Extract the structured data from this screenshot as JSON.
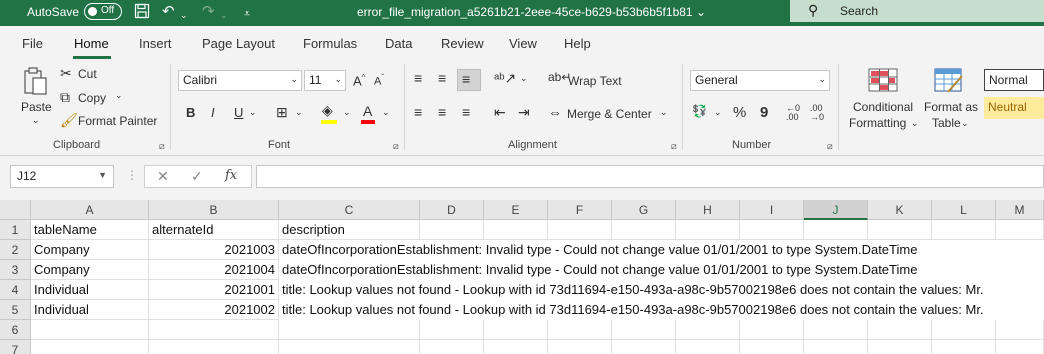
{
  "titlebar": {
    "autosave_label": "AutoSave",
    "autosave_state": "Off",
    "filename": "error_file_migration_a5261b21-2eee-45ce-b629-b53b6b5f1b81",
    "filename_chevron": "⌄",
    "search_label": "Search"
  },
  "menu": {
    "items": [
      "File",
      "Home",
      "Insert",
      "Page Layout",
      "Formulas",
      "Data",
      "Review",
      "View",
      "Help"
    ]
  },
  "ribbon": {
    "clipboard": {
      "paste": "Paste",
      "cut": "Cut",
      "copy": "Copy",
      "format_painter": "Format Painter",
      "group_label": "Clipboard"
    },
    "font": {
      "font_name": "Calibri",
      "font_size": "11",
      "bold": "B",
      "italic": "I",
      "underline": "U",
      "group_label": "Font"
    },
    "alignment": {
      "wrap_text": "Wrap Text",
      "merge_center": "Merge & Center",
      "group_label": "Alignment"
    },
    "number": {
      "format": "General",
      "percent": "%",
      "comma": "9",
      "group_label": "Number"
    },
    "styles": {
      "conditional_line1": "Conditional",
      "conditional_line2": "Formatting",
      "format_table_line1": "Format as",
      "format_table_line2": "Table",
      "normal": "Normal",
      "neutral": "Neutral"
    }
  },
  "formula_bar": {
    "name_box": "J12",
    "fx": "fx",
    "value": ""
  },
  "sheet": {
    "selected_column": "J",
    "columns": [
      "A",
      "B",
      "C",
      "D",
      "E",
      "F",
      "G",
      "H",
      "I",
      "J",
      "K",
      "L",
      "M"
    ],
    "row_numbers": [
      "1",
      "2",
      "3",
      "4",
      "5",
      "6",
      "7"
    ],
    "header": [
      "tableName",
      "alternateId",
      "description"
    ],
    "rows": [
      [
        "Company",
        "2021003",
        "dateOfIncorporationEstablishment: Invalid type - Could not change value 01/01/2001 to type System.DateTime"
      ],
      [
        "Company",
        "2021004",
        "dateOfIncorporationEstablishment: Invalid type - Could not change value 01/01/2001 to type System.DateTime"
      ],
      [
        "Individual",
        "2021001",
        "title: Lookup values not found - Lookup with id 73d11694-e150-493a-a98c-9b57002198e6 does not contain the values: Mr."
      ],
      [
        "Individual",
        "2021002",
        "title: Lookup values not found - Lookup with id 73d11694-e150-493a-a98c-9b57002198e6 does not contain the values: Mr."
      ]
    ]
  },
  "colors": {
    "accent": "#217346",
    "search_bg": "#c6dfcd",
    "neutral_bg": "#ffeb9c"
  }
}
